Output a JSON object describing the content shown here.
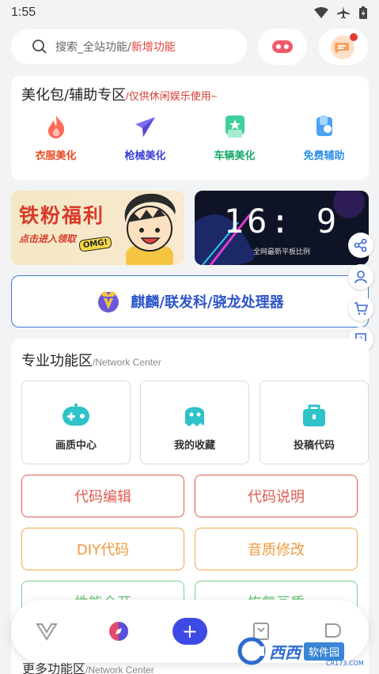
{
  "status": {
    "time": "1:55"
  },
  "search": {
    "placeholder_main": "搜索_全站功能/",
    "placeholder_highlight": "新增功能"
  },
  "beautify": {
    "title": "美化包/辅助专区",
    "subtitle": "/仅供休闲娱乐使用~",
    "items": [
      {
        "label": "衣服美化",
        "color": "#e8481f",
        "icon": "fire-icon"
      },
      {
        "label": "枪械美化",
        "color": "#3b3fd6",
        "icon": "send-icon"
      },
      {
        "label": "车辆美化",
        "color": "#17a86a",
        "icon": "star-box-icon"
      },
      {
        "label": "免费辅助",
        "color": "#2b8fe6",
        "icon": "assist-icon"
      }
    ]
  },
  "banners": {
    "left_title": "铁粉福利",
    "left_sub": "点击进入领取",
    "left_badge": "OMG!",
    "right_clock": "16: 9",
    "right_caption": "全网最新平板比例"
  },
  "processor": {
    "label": "麒麟/联发科/骁龙处理器"
  },
  "pro": {
    "title": "专业功能区",
    "subtitle": "/Network Center",
    "tiles": [
      {
        "label": "画质中心",
        "icon": "gamepad-icon"
      },
      {
        "label": "我的收藏",
        "icon": "ghost-icon"
      },
      {
        "label": "投稿代码",
        "icon": "briefcase-icon"
      }
    ],
    "buttons": [
      {
        "label": "代码编辑",
        "style": "red"
      },
      {
        "label": "代码说明",
        "style": "red"
      },
      {
        "label": "DIY代码",
        "style": "orange"
      },
      {
        "label": "音质修改",
        "style": "orange"
      },
      {
        "label": "性能全开",
        "style": "green"
      },
      {
        "label": "恢复画质",
        "style": "green"
      }
    ]
  },
  "more": {
    "title": "更多功能区",
    "subtitle": "/Network Center"
  },
  "nav": {
    "add_label": "+"
  },
  "watermark": {
    "brand": "西西",
    "box": "软件园",
    "url": "CR173.COM"
  },
  "colors": {
    "accent": "#3f49e6",
    "red": "#e05a4f",
    "orange": "#ef9a3b",
    "green": "#66c474"
  }
}
